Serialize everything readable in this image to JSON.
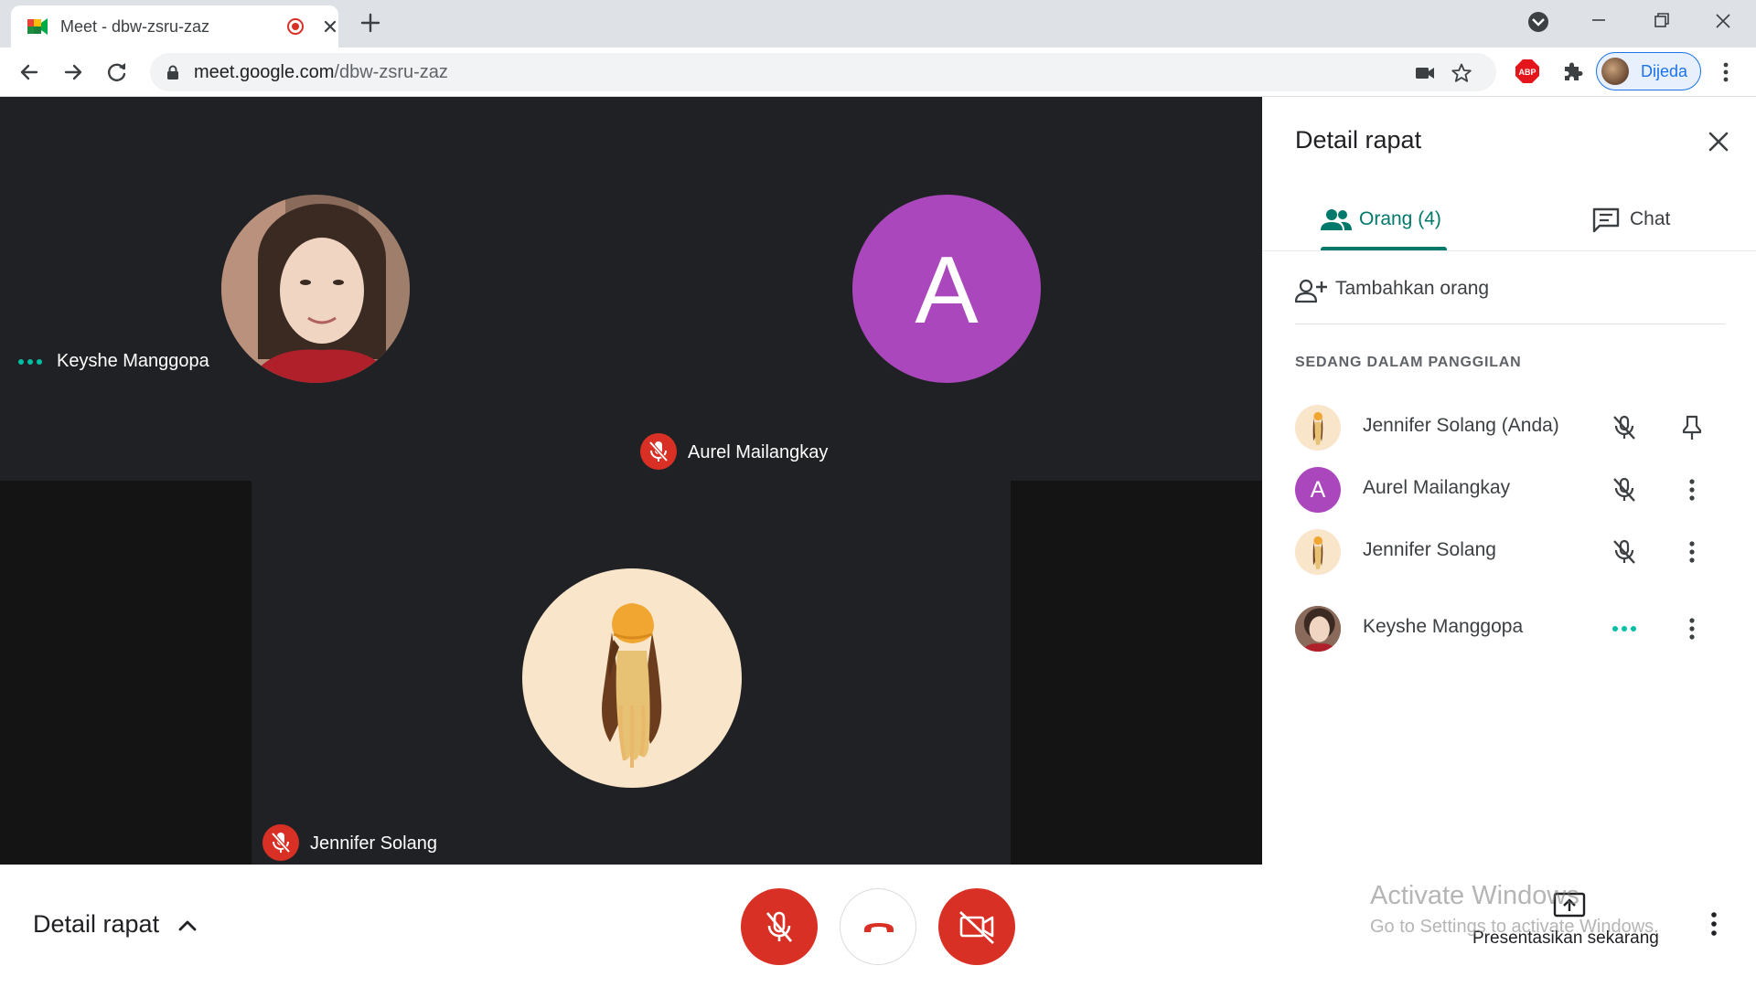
{
  "browser": {
    "tab_title": "Meet - dbw-zsru-zaz",
    "url_host": "meet.google.com",
    "url_path": "/dbw-zsru-zaz",
    "profile_label": "Dijeda",
    "extension_abp": "ABP"
  },
  "stage": {
    "tiles": [
      {
        "name": "Keyshe Manggopa",
        "status": "speaking-dots"
      },
      {
        "name": "Aurel Mailangkay",
        "avatar_letter": "A",
        "status": "muted"
      },
      {
        "name": "Jennifer Solang",
        "status": "muted"
      }
    ],
    "colors": {
      "background": "#202124",
      "avatar_purple": "#ab47bc",
      "muted_red": "#d93025",
      "dots_teal": "#00bfa5"
    }
  },
  "panel": {
    "title": "Detail rapat",
    "tab_people": "Orang (4)",
    "tab_chat": "Chat",
    "add_person": "Tambahkan orang",
    "section_label": "SEDANG DALAM PANGGILAN",
    "people": [
      {
        "name": "Jennifer Solang (Anda)",
        "avatar": "illustration",
        "status_icon": "mic-off-icon",
        "action_icon": "pin-icon"
      },
      {
        "name": "Aurel Mailangkay",
        "avatar": "letter",
        "letter": "A",
        "status_icon": "mic-off-icon",
        "action_icon": "more-vert-icon"
      },
      {
        "name": "Jennifer Solang",
        "avatar": "illustration",
        "status_icon": "mic-off-icon",
        "action_icon": "more-vert-icon"
      },
      {
        "name": "Keyshe Manggopa",
        "avatar": "photo",
        "status_icon": "speaking-dots-icon",
        "action_icon": "more-vert-icon"
      }
    ]
  },
  "bottom": {
    "meeting_details": "Detail rapat",
    "present_now": "Presentasikan sekarang"
  },
  "watermark": {
    "line1": "Activate Windows",
    "line2": "Go to Settings to activate Windows."
  }
}
